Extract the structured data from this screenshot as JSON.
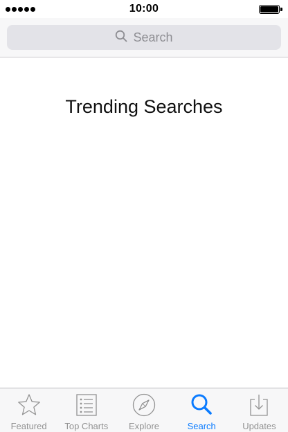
{
  "status_bar": {
    "signal_icon": "signal-dots-icon",
    "time": "10:00",
    "battery_icon": "battery-full-icon"
  },
  "search": {
    "icon": "search-icon",
    "placeholder": "Search"
  },
  "content": {
    "title": "Trending Searches"
  },
  "tab_bar": {
    "items": [
      {
        "label": "Featured",
        "icon": "star-icon",
        "active": false
      },
      {
        "label": "Top Charts",
        "icon": "list-icon",
        "active": false
      },
      {
        "label": "Explore",
        "icon": "compass-icon",
        "active": false
      },
      {
        "label": "Search",
        "icon": "search-icon",
        "active": true
      },
      {
        "label": "Updates",
        "icon": "download-icon",
        "active": false
      }
    ]
  },
  "colors": {
    "accent": "#0a7bff",
    "inactive_tab": "#929292",
    "search_field_bg": "#e3e3e8",
    "placeholder": "#8e8e93"
  }
}
